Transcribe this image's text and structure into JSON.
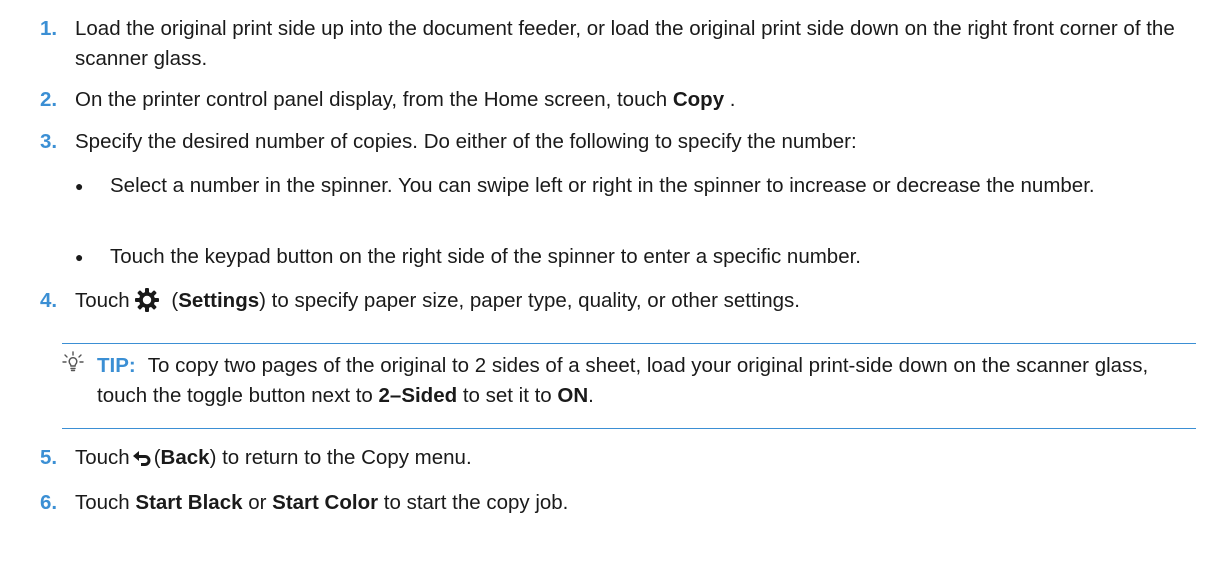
{
  "steps": {
    "s1": {
      "num": "1.",
      "text": "Load the original print side up into the document feeder, or load the original print side down on the right front corner of the scanner glass."
    },
    "s2": {
      "num": "2.",
      "pre": "On the printer control panel display, from the Home screen, touch ",
      "bold": "Copy",
      "post": " ."
    },
    "s3": {
      "num": "3.",
      "text": "Specify the desired number of copies. Do either of the following to specify the number:"
    },
    "bullets": [
      {
        "text": "Select a number in the spinner. You can swipe left or right in the spinner to increase or decrease the number."
      },
      {
        "text": "Touch the keypad button on the right side of the spinner to enter a specific number."
      }
    ],
    "s4": {
      "num": "4.",
      "pre": "Touch",
      "open": " (",
      "bold": "Settings",
      "post": ") to specify paper size, paper type, quality, or other settings."
    },
    "s5": {
      "num": "5.",
      "pre": "Touch",
      "open": "(",
      "bold": "Back",
      "post": ") to return to the Copy menu."
    },
    "s6": {
      "num": "6.",
      "pre": "Touch ",
      "bold1": "Start Black",
      "mid": " or ",
      "bold2": "Start Color",
      "post": " to start the copy job."
    }
  },
  "tip": {
    "label": "TIP:",
    "text1": "To copy two pages of the original to 2 sides of a sheet, load your original print-side down on the scanner glass, touch the toggle button next to ",
    "bold1": "2–Sided",
    "text2": " to set it to ",
    "bold2": "ON",
    "text3": "."
  },
  "icons": {
    "settings": "gear-icon",
    "back": "back-arrow-icon",
    "tip": "lightbulb-icon",
    "bullet": "bullet-dot"
  },
  "colors": {
    "accent": "#3b8fd4",
    "text": "#1a1a1a"
  }
}
